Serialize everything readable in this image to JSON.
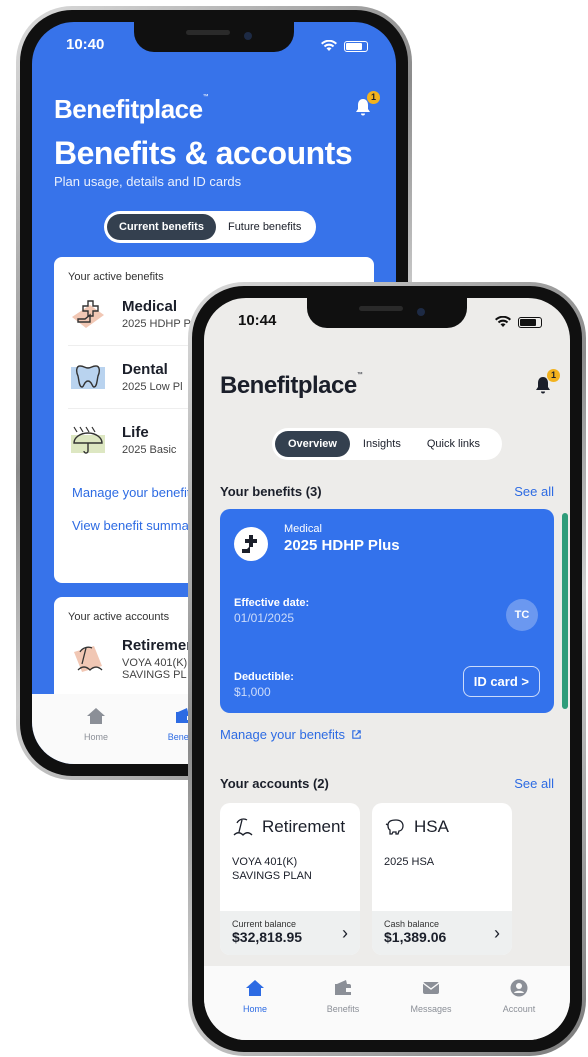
{
  "back_screen": {
    "status_time": "10:40",
    "brand": "Benefitplace",
    "notification_count": "1",
    "title": "Benefits & accounts",
    "subtitle": "Plan usage, details and ID cards",
    "segments": [
      "Current benefits",
      "Future benefits"
    ],
    "active_benefits_label": "Your active benefits",
    "benefits": [
      {
        "name": "Medical",
        "plan": "2025 HDHP P",
        "icon": "medical-icon"
      },
      {
        "name": "Dental",
        "plan": "2025 Low Pl",
        "icon": "tooth-icon"
      },
      {
        "name": "Life",
        "plan": "2025 Basic",
        "icon": "umbrella-icon"
      }
    ],
    "links": [
      "Manage your benefit",
      "View benefit summa"
    ],
    "active_accounts_label": "Your active accounts",
    "account": {
      "name": "Retiremen",
      "desc": "VOYA 401(K) SAVINGS PL"
    },
    "tabs": [
      "Home",
      "Benefits"
    ]
  },
  "front_screen": {
    "status_time": "10:44",
    "brand": "Benefitplace",
    "notification_count": "1",
    "segments": [
      "Overview",
      "Insights",
      "Quick links"
    ],
    "benefits_header": "Your benefits (3)",
    "see_all": "See all",
    "medical_card": {
      "type": "Medical",
      "plan": "2025 HDHP Plus",
      "effective_label": "Effective date:",
      "effective_value": "01/01/2025",
      "initials": "TC",
      "deductible_label": "Deductible:",
      "deductible_value": "$1,000",
      "id_card_label": "ID card >"
    },
    "manage_link": "Manage your benefits",
    "accounts_header": "Your accounts (2)",
    "accounts": [
      {
        "name": "Retirement",
        "desc": "VOYA 401(K) SAVINGS PLAN",
        "balance_label": "Current balance",
        "balance": "$32,818.95",
        "icon": "beach-icon"
      },
      {
        "name": "HSA",
        "desc": "2025 HSA",
        "balance_label": "Cash balance",
        "balance": "$1,389.06",
        "icon": "piggy-bank-icon"
      }
    ],
    "tabs": [
      "Home",
      "Benefits",
      "Messages",
      "Account"
    ]
  },
  "colors": {
    "brand_blue": "#3773ea",
    "link_blue": "#2d6be3",
    "badge": "#f2b21f",
    "dark_pill": "#34404f"
  }
}
